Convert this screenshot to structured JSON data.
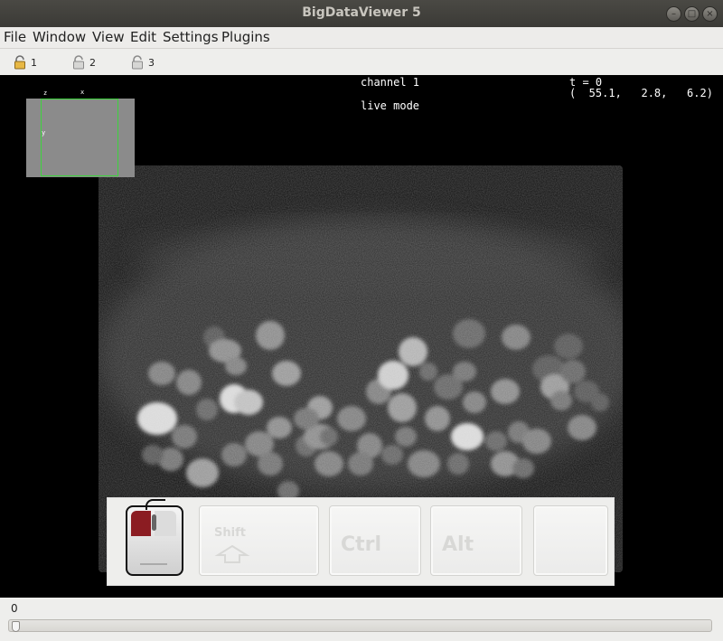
{
  "window": {
    "title": "BigDataViewer 5",
    "buttons": [
      "minimize",
      "maximize",
      "close"
    ]
  },
  "menubar": {
    "items": [
      "File",
      "Window",
      "View",
      "Edit",
      "Settings",
      "Plugins"
    ]
  },
  "toolbar": {
    "locks": [
      "1",
      "2",
      "3"
    ],
    "lock_icon": "padlock-icon"
  },
  "viewer": {
    "channel": "channel 1",
    "mode": "live mode",
    "timepoint": "t = 0",
    "coordinates": "(  55.1,   2.8,   6.2)",
    "minimap": {
      "axis_z": "z",
      "axis_x": "x",
      "axis_y": "y",
      "frame_color": "#3cd33c"
    },
    "modifier_keys": [
      "Shift",
      "Ctrl",
      "Alt",
      ""
    ]
  },
  "slider": {
    "label": "0",
    "value": 0
  }
}
